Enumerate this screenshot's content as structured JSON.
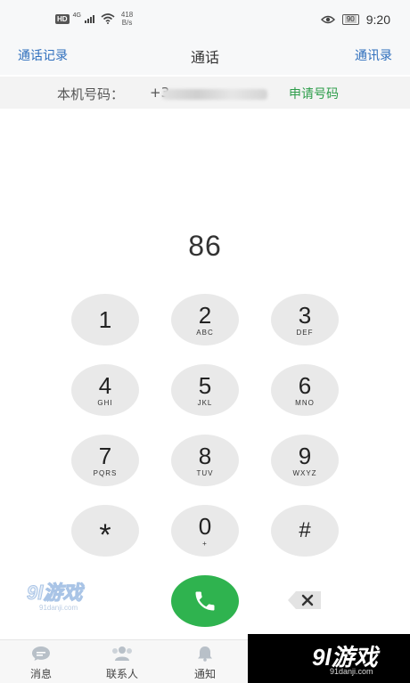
{
  "status_bar": {
    "hd": "HD",
    "network": "4G",
    "speed_value": "418",
    "speed_unit": "B/s",
    "battery": "90",
    "time": "9:20"
  },
  "header": {
    "left_link": "通话记录",
    "title": "通话",
    "right_link": "通讯录"
  },
  "number_row": {
    "label": "本机号码：",
    "value": "+3",
    "apply_link": "申请号码"
  },
  "dialed_number": "86",
  "keypad": [
    {
      "digit": "1",
      "letters": ""
    },
    {
      "digit": "2",
      "letters": "ABC"
    },
    {
      "digit": "3",
      "letters": "DEF"
    },
    {
      "digit": "4",
      "letters": "GHI"
    },
    {
      "digit": "5",
      "letters": "JKL"
    },
    {
      "digit": "6",
      "letters": "MNO"
    },
    {
      "digit": "7",
      "letters": "PQRS"
    },
    {
      "digit": "8",
      "letters": "TUV"
    },
    {
      "digit": "9",
      "letters": "WXYZ"
    },
    {
      "digit": "*",
      "letters": ""
    },
    {
      "digit": "0",
      "letters": "+"
    },
    {
      "digit": "#",
      "letters": ""
    }
  ],
  "call_button_icon": "phone-icon",
  "backspace_icon": "backspace-icon",
  "bottom_nav": [
    {
      "label": "消息",
      "icon": "chat-bubble-icon"
    },
    {
      "label": "联系人",
      "icon": "contacts-icon"
    },
    {
      "label": "通知",
      "icon": "bell-icon"
    }
  ],
  "watermark": {
    "main": "9l游戏",
    "sub": "91danji.com"
  },
  "colors": {
    "accent_blue": "#2f6fbd",
    "accent_green": "#2d9d4a",
    "call_green": "#2fb34f",
    "key_gray": "#e9e9e9"
  }
}
